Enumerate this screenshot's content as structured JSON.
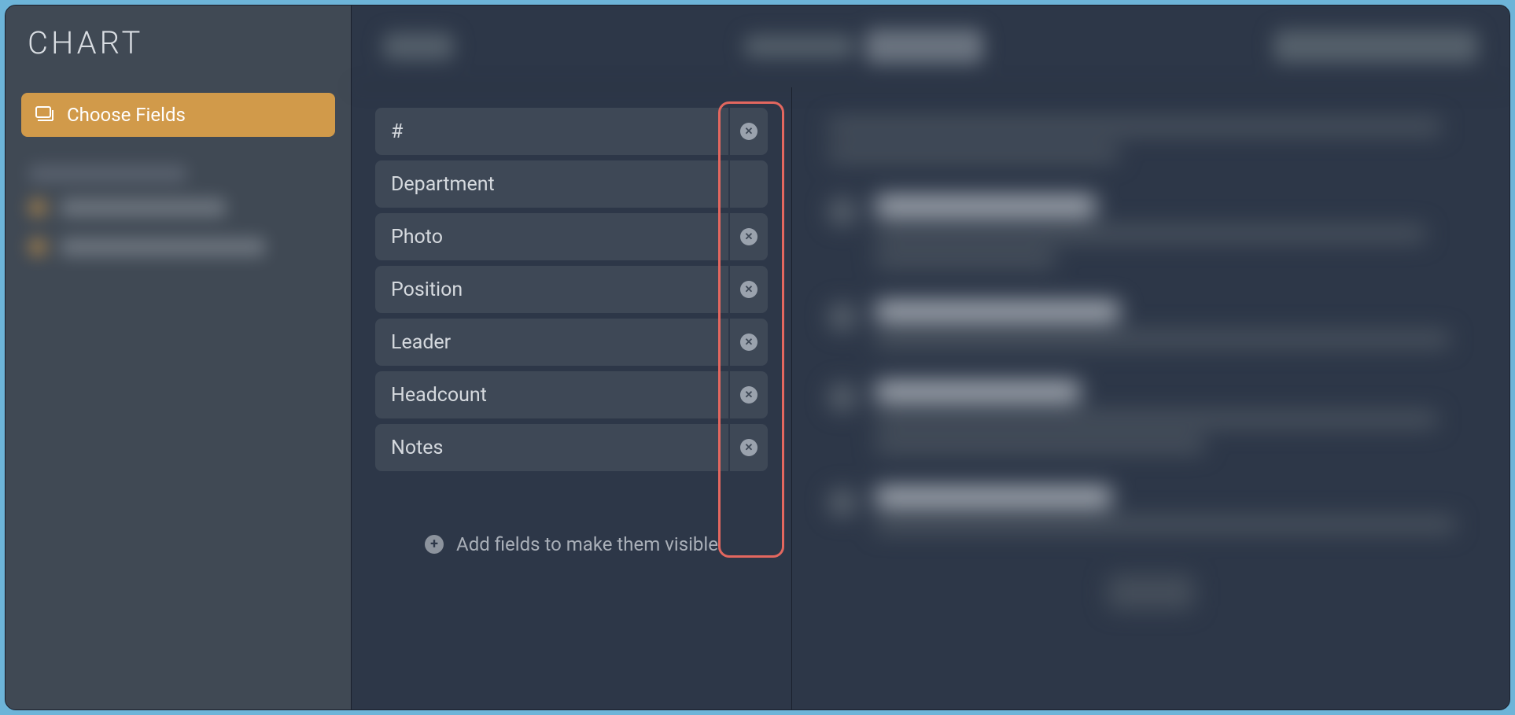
{
  "sidebar": {
    "title": "CHART",
    "choose_fields_label": "Choose Fields"
  },
  "fields": [
    {
      "label": "#",
      "removable": true
    },
    {
      "label": "Department",
      "removable": false
    },
    {
      "label": "Photo",
      "removable": true
    },
    {
      "label": "Position",
      "removable": true
    },
    {
      "label": "Leader",
      "removable": true
    },
    {
      "label": "Headcount",
      "removable": true
    },
    {
      "label": "Notes",
      "removable": true
    }
  ],
  "add_fields_hint": "Add fields to make them visible"
}
